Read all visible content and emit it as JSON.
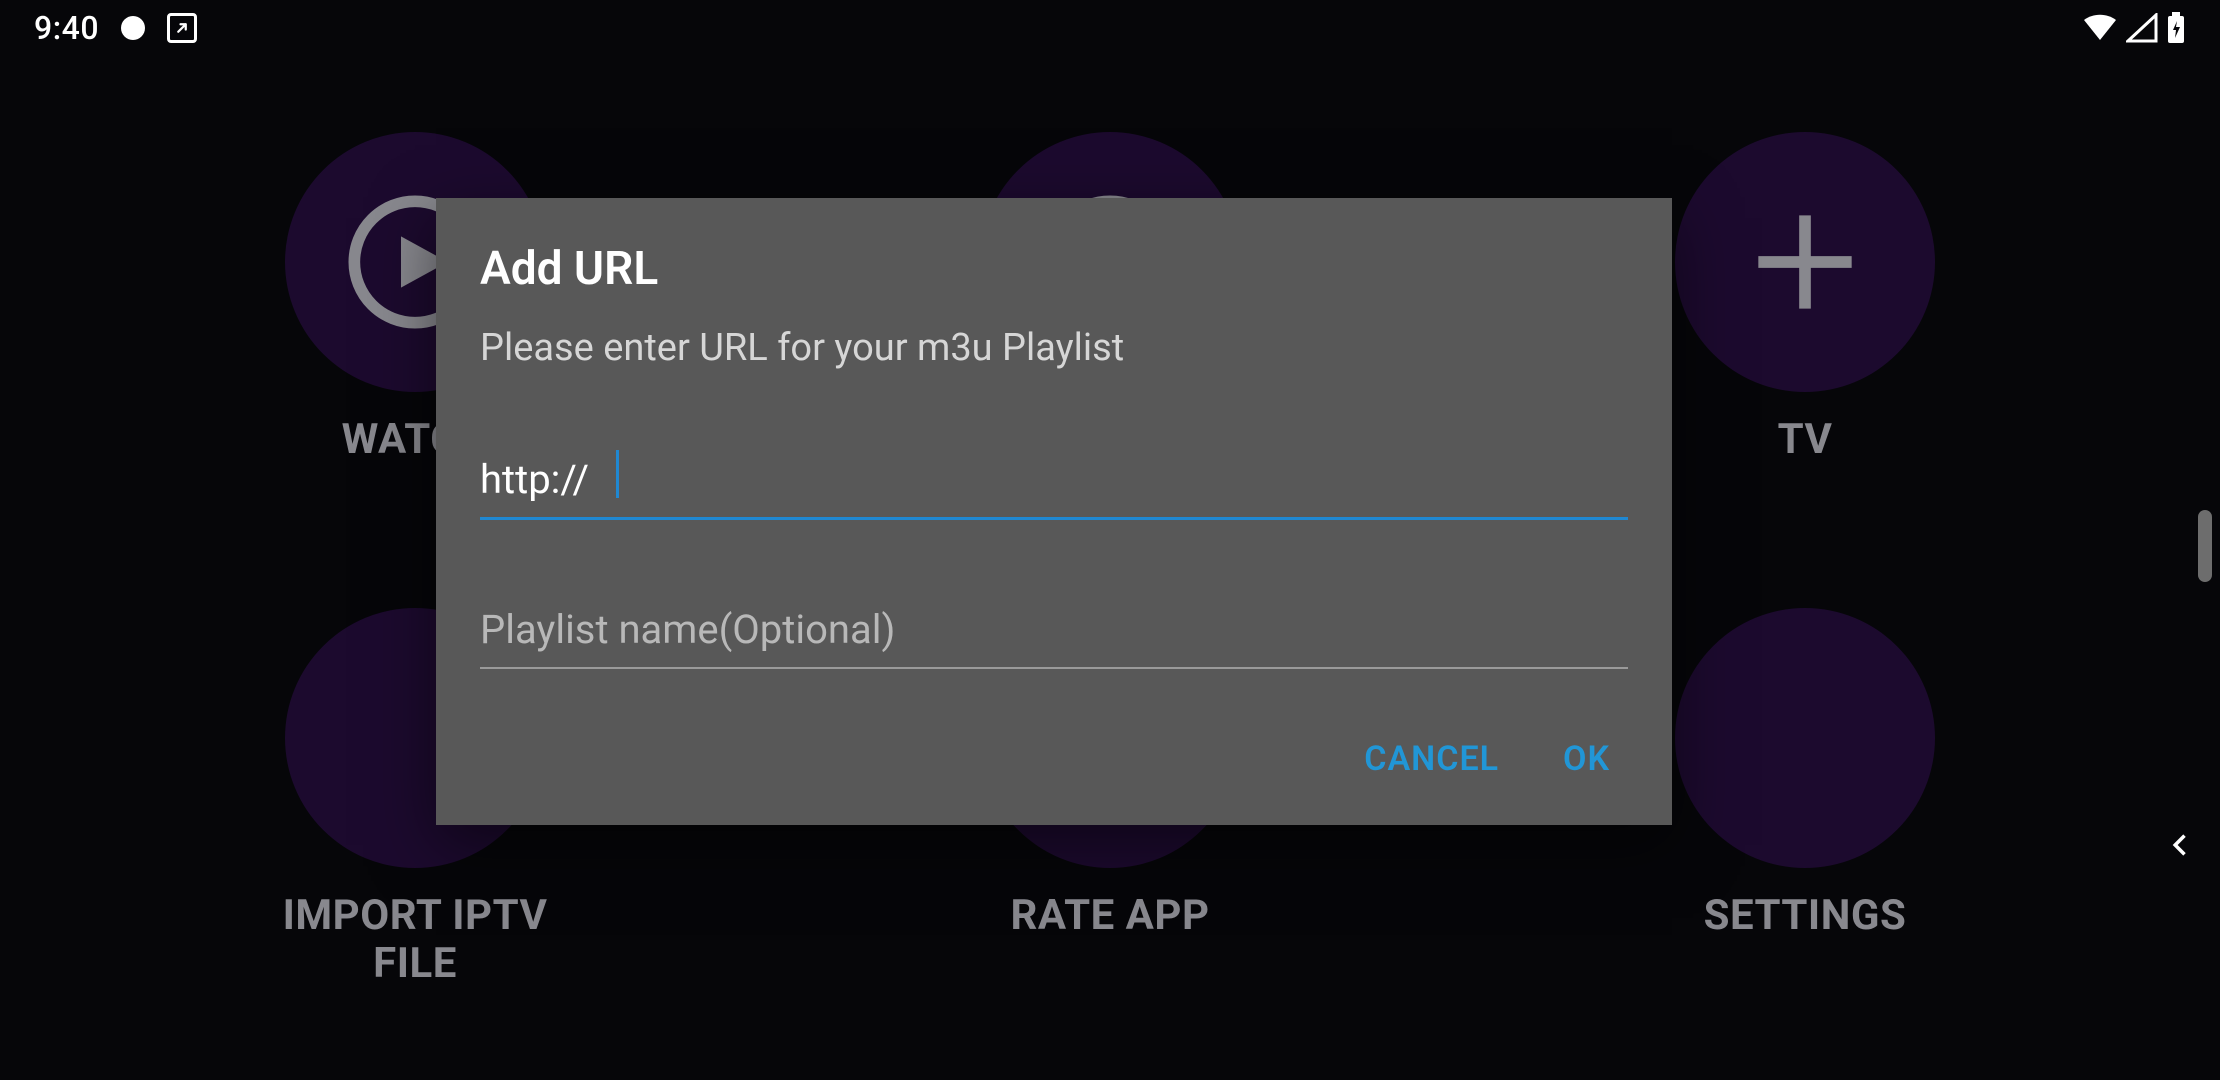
{
  "status_bar": {
    "time": "9:40"
  },
  "background": {
    "row1": [
      {
        "label": "WATCH"
      },
      {
        "label": ""
      },
      {
        "label": "TV"
      }
    ],
    "row2": [
      {
        "label": "IMPORT IPTV FILE"
      },
      {
        "label": "RATE APP"
      },
      {
        "label": "SETTINGS"
      }
    ]
  },
  "dialog": {
    "title": "Add URL",
    "subtitle": "Please enter URL for your m3u Playlist",
    "url_value": "http://",
    "playlist_placeholder": "Playlist name(Optional)",
    "cancel_label": "CANCEL",
    "ok_label": "OK"
  }
}
